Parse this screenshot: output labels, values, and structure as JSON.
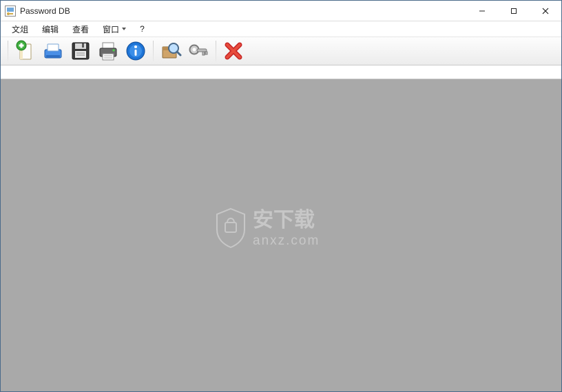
{
  "titlebar": {
    "title": "Password DB"
  },
  "menu": {
    "file": "文俎",
    "edit": "编辑",
    "view": "查看",
    "window": "窗口",
    "help": "?"
  },
  "toolbar": {
    "new": "New",
    "open": "Open",
    "save": "Save",
    "print": "Print",
    "info": "Info",
    "find": "Find",
    "key": "Key",
    "delete": "Delete"
  },
  "watermark": {
    "text_main": "安下载",
    "text_sub": "anxz.com"
  }
}
